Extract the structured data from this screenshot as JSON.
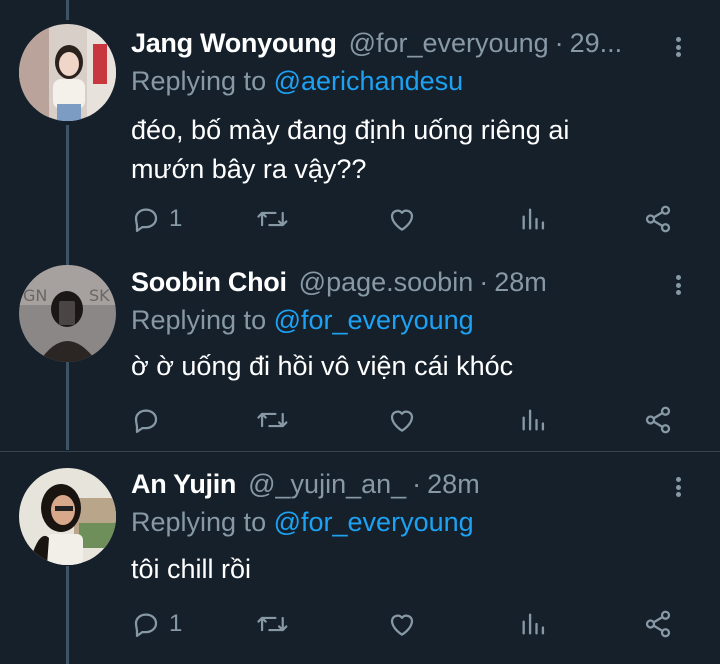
{
  "colors": {
    "background": "#15202b",
    "secondary_text": "#8899a6",
    "accent": "#1da1f2",
    "divider": "#38444d",
    "thread_line": "#3d5466"
  },
  "tweets": [
    {
      "name": "Jang Wonyoung",
      "handle": "@for_everyoung",
      "separator": "·",
      "time": "29...",
      "replying_prefix": "Replying to",
      "replying_to": "@aerichandesu",
      "text_line1": "đéo, bố mày đang định uống riêng ai",
      "text_line2": "mướn bây ra vậy??",
      "reply_count": "1",
      "retweet_count": "",
      "like_count": ""
    },
    {
      "name": "Soobin Choi",
      "handle": "@page.soobin",
      "separator": "·",
      "time": "28m",
      "replying_prefix": "Replying to",
      "replying_to": "@for_everyoung",
      "text_line1": "ờ ờ uống đi hồi vô viện cái khóc",
      "reply_count": "",
      "retweet_count": "",
      "like_count": ""
    },
    {
      "name": "An Yujin",
      "handle": "@_yujin_an_",
      "separator": "·",
      "time": "28m",
      "replying_prefix": "Replying to",
      "replying_to": "@for_everyoung",
      "text_line1": "tôi chill rồi",
      "reply_count": "1",
      "retweet_count": "",
      "like_count": ""
    }
  ],
  "icons": {
    "reply": "reply-bubble-icon",
    "retweet": "retweet-icon",
    "like": "heart-icon",
    "analytics": "analytics-bars-icon",
    "share": "share-icon",
    "more": "more-vertical-icon"
  }
}
